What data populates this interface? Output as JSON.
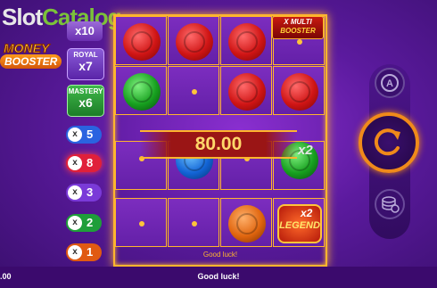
{
  "watermark": {
    "part1": "Slot",
    "part2": "Catalog"
  },
  "logo": {
    "line1": "MONEY",
    "line2": "BOOSTER"
  },
  "multipliers": {
    "top_value": "x10",
    "royal": {
      "title": "ROYAL",
      "value": "x7"
    },
    "mastery": {
      "title": "MASTERY",
      "value": "x6"
    },
    "chips": [
      {
        "mult": "x",
        "value": "5",
        "color": "#2a63e0"
      },
      {
        "mult": "x",
        "value": "8",
        "color": "#e0203a"
      },
      {
        "mult": "x",
        "value": "3",
        "color": "#7a3ad8"
      },
      {
        "mult": "x",
        "value": "2",
        "color": "#1f9e3a"
      },
      {
        "mult": "x",
        "value": "1",
        "color": "#e05a12"
      }
    ]
  },
  "grid": {
    "booster_badge": {
      "line1": "X MULTI",
      "line2": "BOOSTER"
    },
    "win_amount": "80.00",
    "mult_badge": "x2",
    "legend_badge": {
      "mult": "x2",
      "label": "LEGEND"
    },
    "message": "Good luck!"
  },
  "status": {
    "balance_partial": ".00",
    "message": "Good luck!"
  },
  "icons": {
    "autoplay": "autoplay-icon",
    "spin": "spin-icon",
    "bet": "coins-stack-icon"
  },
  "colors": {
    "frame": "#ffb52e",
    "spin_ring": "#f08a1a",
    "background": "#5b1a9e"
  }
}
